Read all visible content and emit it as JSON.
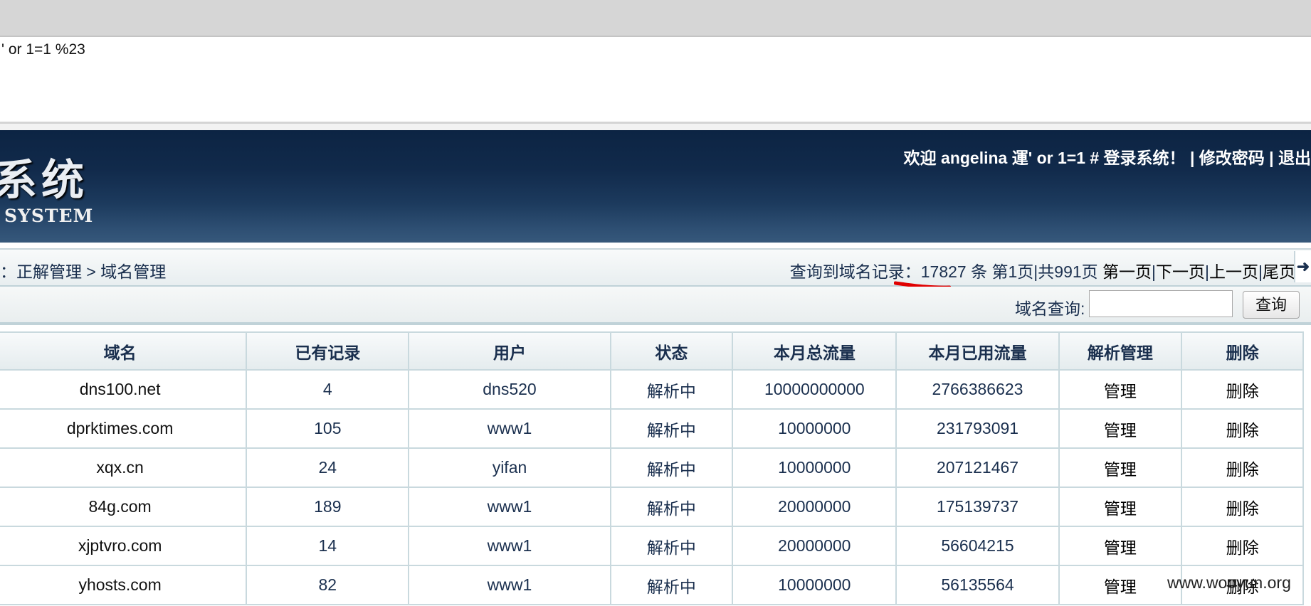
{
  "query_input": {
    "value": "' or 1=1 %23"
  },
  "header": {
    "brand_cn": "系统",
    "brand_en": "SYSTEM",
    "welcome": "欢迎 angelina 運' or 1=1 # 登录系统！ | ",
    "change_password": "修改密码",
    "separator": " | ",
    "logout": "退出"
  },
  "nav": {
    "breadcrumb": "：正解管理 > 域名管理",
    "records_label": "查询到域名记录：",
    "records_count": "17827",
    "records_unit": " 条 第1页|共991页 ",
    "first_page": "第一页",
    "pipe": "|",
    "next_page": "下一页",
    "prev_page": "上一页",
    "last_page": "尾页",
    "arrow": "➜"
  },
  "search": {
    "label": "域名查询:",
    "placeholder": "",
    "button": "查询"
  },
  "table": {
    "headers": [
      "域名",
      "已有记录",
      "用户",
      "状态",
      "本月总流量",
      "本月已用流量",
      "解析管理",
      "删除"
    ],
    "rows": [
      [
        "dns100.net",
        "4",
        "dns520",
        "解析中",
        "10000000000",
        "2766386623",
        "管理",
        "删除"
      ],
      [
        "dprktimes.com",
        "105",
        "www1",
        "解析中",
        "10000000",
        "231793091",
        "管理",
        "删除"
      ],
      [
        "xqx.cn",
        "24",
        "yifan",
        "解析中",
        "10000000",
        "207121467",
        "管理",
        "删除"
      ],
      [
        "84g.com",
        "189",
        "www1",
        "解析中",
        "20000000",
        "175139737",
        "管理",
        "删除"
      ],
      [
        "xjptvro.com",
        "14",
        "www1",
        "解析中",
        "20000000",
        "56604215",
        "管理",
        "删除"
      ],
      [
        "yhosts.com",
        "82",
        "www1",
        "解析中",
        "10000000",
        "56135564",
        "管理",
        "删除"
      ]
    ]
  },
  "watermark": "www.wooyun.org",
  "colors": {
    "header_dark": "#0c2443",
    "header_light": "#36587b",
    "border": "#c9d9de",
    "text": "#1a2f4e",
    "annotation": "#e00000"
  }
}
